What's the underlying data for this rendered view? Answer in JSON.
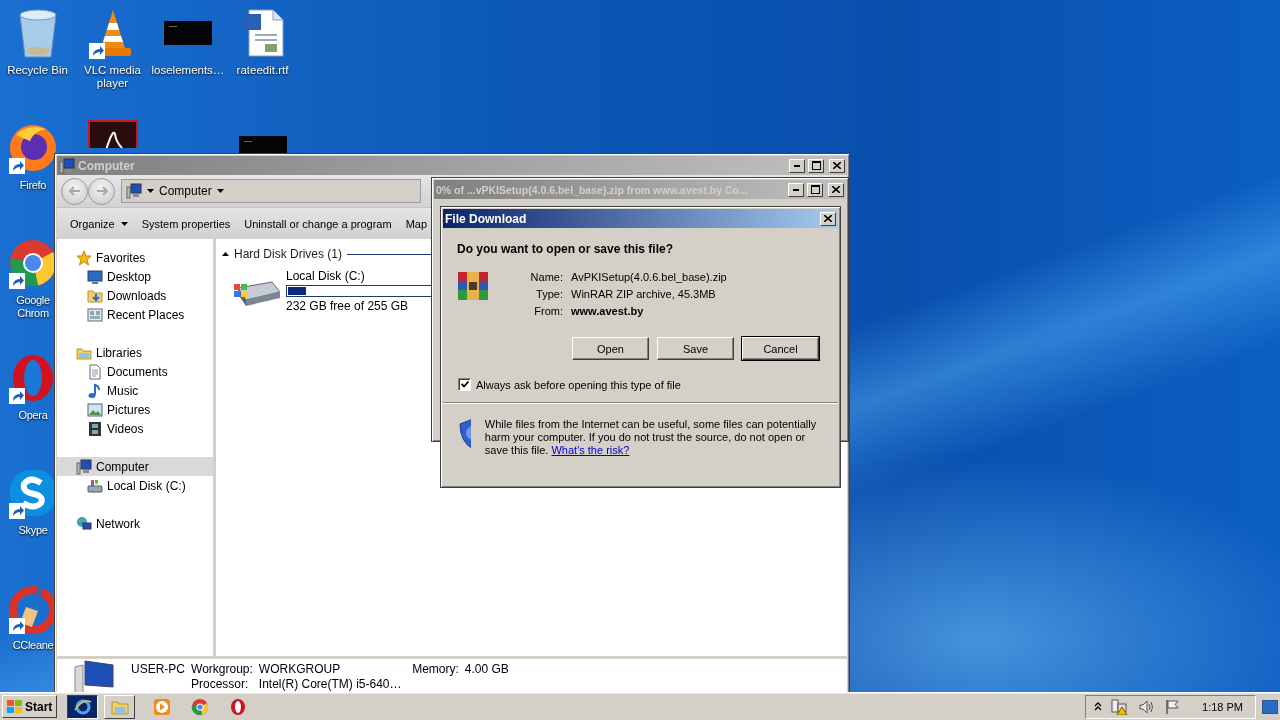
{
  "desktop": {
    "icon_columns": [
      [
        {
          "kind": "recycle-bin",
          "label": "Recycle Bin",
          "shortcut": false
        },
        {
          "kind": "firefox",
          "label": "Firefo",
          "shortcut": true
        },
        {
          "kind": "chrome",
          "label": "Google Chrom",
          "shortcut": true
        },
        {
          "kind": "opera",
          "label": "Opera",
          "shortcut": true
        },
        {
          "kind": "skype",
          "label": "Skype",
          "shortcut": true
        },
        {
          "kind": "ccleaner",
          "label": "CCleane",
          "shortcut": true
        }
      ],
      [
        {
          "kind": "vlc",
          "label": "VLC media player",
          "shortcut": true
        },
        {
          "kind": "acrobat"
        }
      ],
      [
        {
          "kind": "thumbnail",
          "label": "loselements…",
          "shortcut": false
        }
      ],
      [
        {
          "kind": "word-doc",
          "label": "rateedit.rtf",
          "shortcut": false
        },
        {
          "kind": "thumbnail"
        }
      ]
    ]
  },
  "explorer": {
    "title": "Computer",
    "active": false,
    "address": "Computer",
    "toolbar": [
      {
        "label": "Organize",
        "dropdown": true
      },
      {
        "label": "System properties",
        "dropdown": false
      },
      {
        "label": "Uninstall or change a program",
        "dropdown": false
      },
      {
        "label": "Map",
        "dropdown": false
      }
    ],
    "nav": [
      {
        "label": "Favorites",
        "kind": "favorites",
        "selected": false,
        "children": [
          {
            "label": "Desktop",
            "kind": "desktop",
            "selected": false
          },
          {
            "label": "Downloads",
            "kind": "downloads",
            "selected": false
          },
          {
            "label": "Recent Places",
            "kind": "recent",
            "selected": false
          }
        ]
      },
      {
        "label": "Libraries",
        "kind": "libraries",
        "selected": false,
        "children": [
          {
            "label": "Documents",
            "kind": "documents",
            "selected": false
          },
          {
            "label": "Music",
            "kind": "music",
            "selected": false
          },
          {
            "label": "Pictures",
            "kind": "pictures",
            "selected": false
          },
          {
            "label": "Videos",
            "kind": "videos",
            "selected": false
          }
        ]
      },
      {
        "label": "Computer",
        "kind": "computer",
        "selected": true,
        "children": [
          {
            "label": "Local Disk (C:)",
            "kind": "disk",
            "selected": false
          }
        ]
      },
      {
        "label": "Network",
        "kind": "network",
        "selected": false
      }
    ],
    "content": {
      "groups": [
        {
          "title": "Hard Disk Drives (1)",
          "expanded": true,
          "drives": [
            {
              "name": "Local Disk (C:)",
              "level": 0.09,
              "free": "232 GB free of 255 GB"
            }
          ]
        }
      ]
    },
    "details": {
      "name": "USER-PC",
      "fields": [
        {
          "label": "Workgroup:",
          "value": "WORKGROUP"
        },
        {
          "label": "Memory:",
          "value": "4.00 GB"
        },
        {
          "label": "Processor:",
          "value": "Intel(R) Core(TM) i5-640…"
        }
      ]
    }
  },
  "download_window": {
    "title": "0% of ...vPKISetup(4.0.6.bel_base).zip from www.avest.by Co...",
    "active": false
  },
  "file_dialog": {
    "title": "File Download",
    "active": true,
    "question": "Do you want to open or save this file?",
    "fields": [
      {
        "label": "Name:",
        "value": "AvPKISetup(4.0.6.bel_base).zip",
        "bold": false
      },
      {
        "label": "Type:",
        "value": "WinRAR ZIP archive, 45.3MB",
        "bold": false
      },
      {
        "label": "From:",
        "value": "www.avest.by",
        "bold": true
      }
    ],
    "buttons": [
      {
        "label": "Open",
        "default": false
      },
      {
        "label": "Save",
        "default": false
      },
      {
        "label": "Cancel",
        "default": true
      }
    ],
    "checkbox": {
      "label": "Always ask before opening this type of file",
      "checked": true
    },
    "warning": "While files from the Internet can be useful, some files can potentially harm your computer. If you do not trust the source, do not open or save this file.",
    "link": "What's the risk?"
  },
  "taskbar": {
    "start": "Start",
    "buttons": [
      {
        "kind": "ie",
        "selected": true
      },
      {
        "kind": "explorer",
        "selected": false
      }
    ],
    "quick_launch": [
      {
        "kind": "media-player"
      },
      {
        "kind": "chrome"
      },
      {
        "kind": "opera"
      }
    ],
    "tray_icons": [
      {
        "kind": "chevron"
      },
      {
        "kind": "network-warning"
      },
      {
        "kind": "speaker"
      },
      {
        "kind": "flag"
      }
    ],
    "clock": "1:18 PM"
  }
}
